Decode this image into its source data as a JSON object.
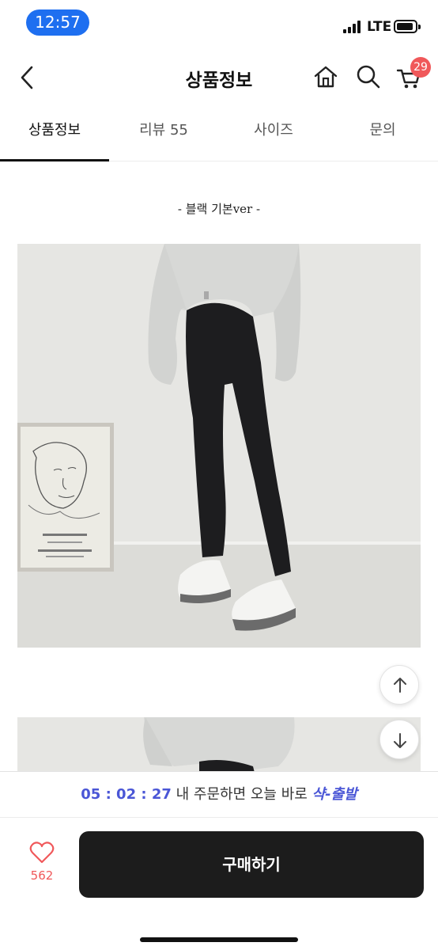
{
  "status_bar": {
    "time": "12:57",
    "network": "LTE",
    "time_pill_color": "#1e6ff0"
  },
  "header": {
    "title": "상품정보",
    "back_icon": "chevron-left-icon",
    "home_icon": "home-icon",
    "search_icon": "search-icon",
    "cart_icon": "cart-icon",
    "cart_count": "29",
    "badge_color": "#f0585a"
  },
  "tabs": [
    {
      "label": "상품정보",
      "active": true
    },
    {
      "label": "리뷰 55",
      "active": false
    },
    {
      "label": "사이즈",
      "active": false
    },
    {
      "label": "문의",
      "active": false
    }
  ],
  "product": {
    "variant_caption": "- 블랙 기본ver -"
  },
  "shipping_timer": {
    "time": "05 : 02 : 27",
    "text": " 내 주문하면 오늘 바로 ",
    "highlight": "샥-출발",
    "accent_color": "#4a56d6"
  },
  "like": {
    "icon": "heart-outline-icon",
    "count": "562"
  },
  "buy_button": {
    "label": "구매하기",
    "color": "#1c1c1c"
  },
  "scroll_buttons": {
    "up_icon": "arrow-up-icon",
    "down_icon": "arrow-down-icon"
  }
}
